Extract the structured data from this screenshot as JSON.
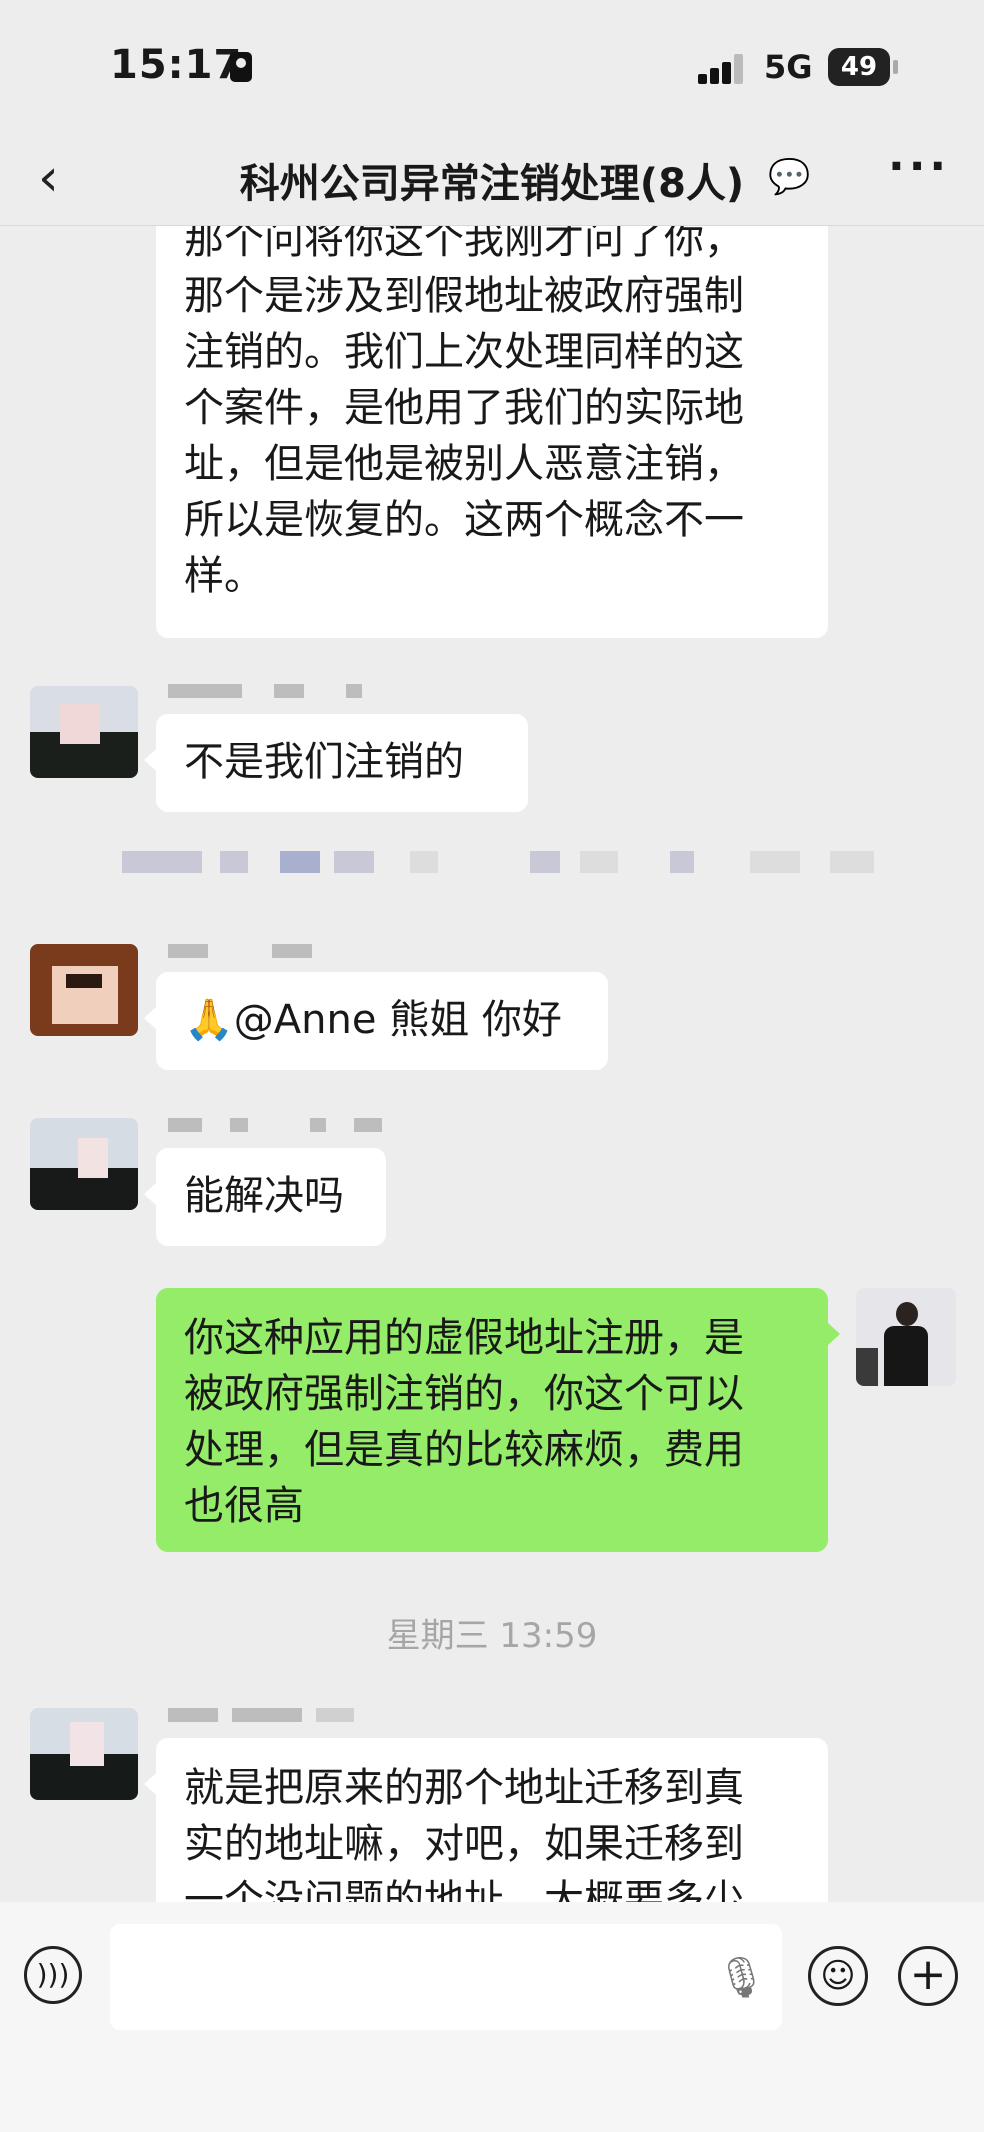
{
  "status_bar": {
    "time": "15:17",
    "network": "5G",
    "battery": "49"
  },
  "header": {
    "back_icon": "chevron-left-icon",
    "title": "科州公司异常注销处理(8人)",
    "title_icon": "chat-bubble-icon",
    "more_icon": "more-dots-icon"
  },
  "messages": [
    {
      "side": "left",
      "text": "那个问将你这个我刚才问了你，\n那个是涉及到假地址被政府强制\n注销的。我们上次处理同样的这\n个案件，是他用了我们的实际地\n址，但是他是被别人恶意注销，\n所以是恢复的。这两个概念不一\n样。"
    },
    {
      "side": "left",
      "text": "不是我们注销的"
    },
    {
      "side": "left",
      "text": "🙏@Anne 熊姐 你好"
    },
    {
      "side": "left",
      "text": "能解决吗"
    },
    {
      "side": "right",
      "text": "你这种应用的虚假地址注册，是\n被政府强制注销的，你这个可以\n处理，但是真的比较麻烦，费用\n也很高"
    },
    {
      "side": "left",
      "text": "就是把原来的那个地址迁移到真\n实的地址嘛，对吧，如果迁移到\n一个没问题的地址，大概要多少"
    }
  ],
  "timestamp": "星期三 13:59",
  "input": {
    "placeholder": "",
    "voice_icon": "voice-icon",
    "mic_icon": "microphone-icon",
    "emoji_icon": "emoji-icon",
    "plus_icon": "plus-icon"
  }
}
